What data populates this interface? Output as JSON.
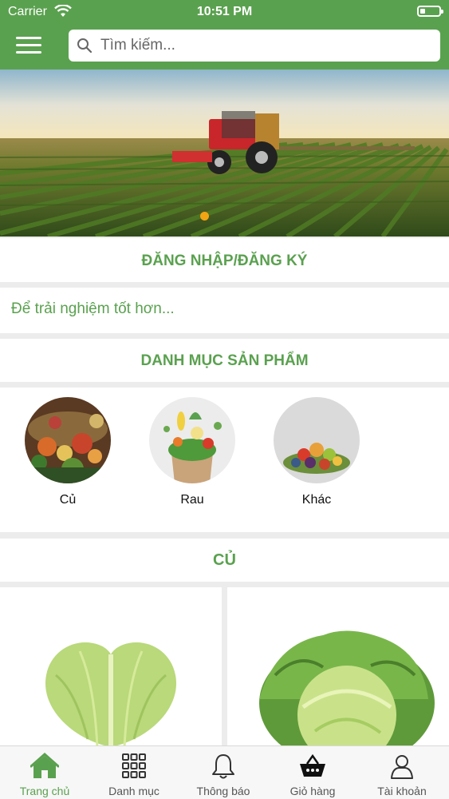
{
  "status_bar": {
    "carrier": "Carrier",
    "time": "10:51 PM"
  },
  "header": {
    "search_placeholder": "Tìm kiếm..."
  },
  "login": {
    "title": "ĐĂNG NHẬP/ĐĂNG KÝ",
    "subtitle": "Để trải nghiệm tốt hơn..."
  },
  "categories": {
    "title": "DANH MỤC SẢN PHẨM",
    "items": [
      {
        "label": "Củ"
      },
      {
        "label": "Rau"
      },
      {
        "label": "Khác"
      }
    ]
  },
  "section_cu": {
    "title": "CỦ"
  },
  "tabbar": {
    "active": "Trang chủ",
    "items": [
      {
        "label": "Trang chủ",
        "icon": "home-icon"
      },
      {
        "label": "Danh mục",
        "icon": "grid-icon"
      },
      {
        "label": "Thông báo",
        "icon": "bell-icon"
      },
      {
        "label": "Giỏ hàng",
        "icon": "basket-icon"
      },
      {
        "label": "Tài khoản",
        "icon": "user-icon"
      }
    ]
  },
  "colors": {
    "brand": "#5aa14f",
    "indicator": "#f2a413"
  }
}
